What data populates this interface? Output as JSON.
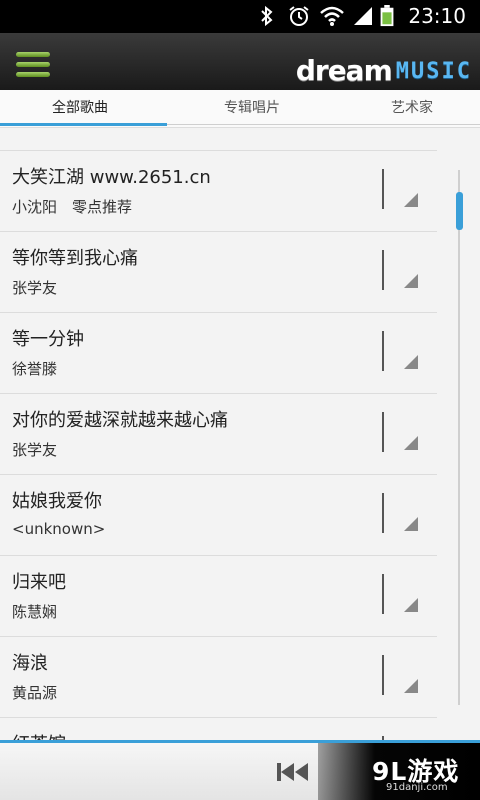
{
  "statusbar": {
    "time": "23:10",
    "icons": [
      "bluetooth-icon",
      "alarm-icon",
      "wifi-icon",
      "signal-icon",
      "battery-icon"
    ]
  },
  "header": {
    "logo_dream": "dream",
    "logo_music": "MUSIC",
    "menu_icon": "hamburger-menu-icon"
  },
  "tabs": [
    {
      "label": "全部歌曲",
      "active": true
    },
    {
      "label": "专辑唱片",
      "active": false
    },
    {
      "label": "艺术家",
      "active": false
    }
  ],
  "songs": [
    {
      "title": "大笑江湖 www.2651.cn",
      "artist": "小沈阳　零点推荐"
    },
    {
      "title": "等你等到我心痛",
      "artist": "张学友"
    },
    {
      "title": "等一分钟",
      "artist": "徐誉滕"
    },
    {
      "title": "对你的爱越深就越来越心痛",
      "artist": "张学友"
    },
    {
      "title": "姑娘我爱你",
      "artist": "<unknown>"
    },
    {
      "title": "归来吧",
      "artist": "陈慧娴"
    },
    {
      "title": "海浪",
      "artist": "黄品源"
    },
    {
      "title": "红茶馆",
      "artist": ""
    }
  ],
  "player": {
    "prev_icon": "previous-track-icon"
  },
  "watermark": {
    "text": "9L游戏",
    "url": "91danji.com"
  },
  "colors": {
    "accent": "#3a9fd8",
    "menu_green": "#7fb33a",
    "logo_blue": "#59b7f2"
  }
}
